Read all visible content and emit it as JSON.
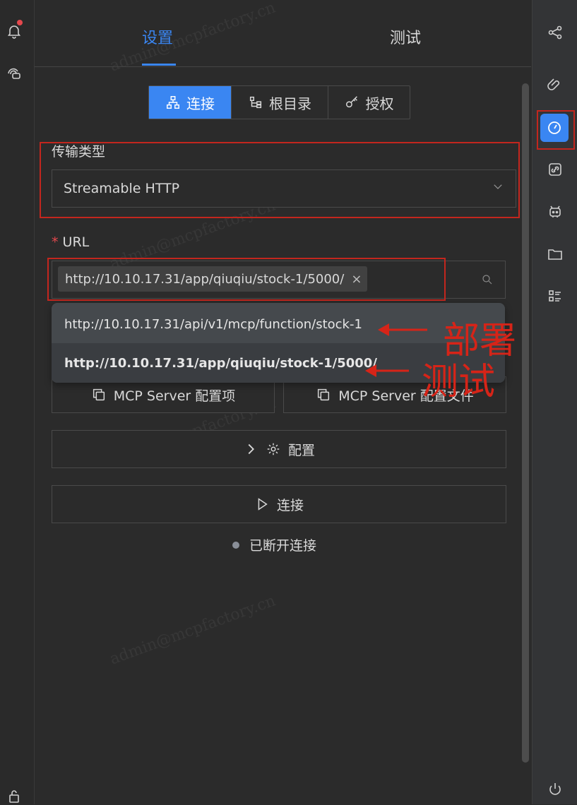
{
  "tabs": {
    "settings": "设置",
    "test": "测试"
  },
  "segments": {
    "connect": "连接",
    "root": "根目录",
    "auth": "授权"
  },
  "transport": {
    "label": "传输类型",
    "value": "Streamable HTTP"
  },
  "url": {
    "required_mark": "*",
    "label": "URL",
    "tag_value": "http://10.10.17.31/app/qiuqiu/stock-1/5000/",
    "tag_close": "×"
  },
  "dropdown": {
    "items": [
      "http://10.10.17.31/api/v1/mcp/function/stock-1",
      "http://10.10.17.31/app/qiuqiu/stock-1/5000/"
    ]
  },
  "buttons": {
    "server_config_item": "MCP Server 配置项",
    "server_config_file": "MCP Server 配置文件",
    "config": "配置",
    "connect": "连接"
  },
  "status": {
    "text": "已断开连接"
  },
  "annotations": {
    "deploy": "部署",
    "test": "测试"
  },
  "watermark": "admin@mcpfactory.cn",
  "colors": {
    "accent": "#3a86f2",
    "annotation_red": "#d62418",
    "background": "#2b2b2b"
  }
}
